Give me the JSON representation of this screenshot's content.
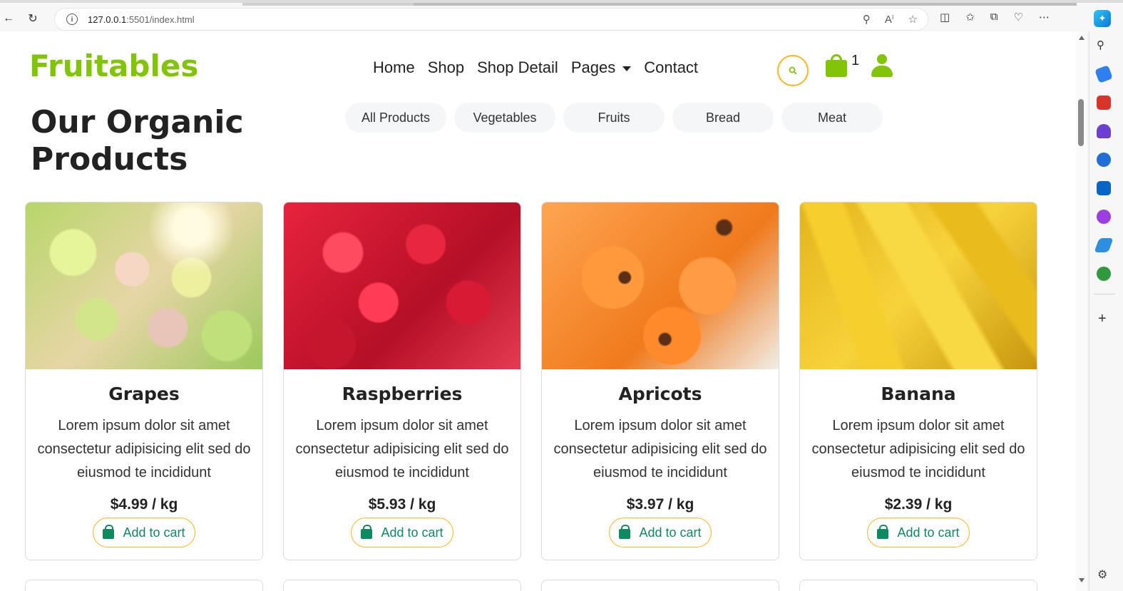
{
  "browser": {
    "url_host": "127.0.0.1",
    "url_rest": ":5501/index.html"
  },
  "site": {
    "brand": "Fruitables",
    "nav": [
      "Home",
      "Shop",
      "Shop Detail",
      "Pages",
      "Contact"
    ],
    "cart_count": "1"
  },
  "section": {
    "title": "Our Organic Products",
    "filters": [
      "All Products",
      "Vegetables",
      "Fruits",
      "Bread",
      "Meat"
    ]
  },
  "products": [
    {
      "name": "Grapes",
      "description": "Lorem ipsum dolor sit amet consectetur adipisicing elit sed do eiusmod te incididunt",
      "price": "$4.99 / kg",
      "button": "Add to cart",
      "image": "grapes"
    },
    {
      "name": "Raspberries",
      "description": "Lorem ipsum dolor sit amet consectetur adipisicing elit sed do eiusmod te incididunt",
      "price": "$5.93 / kg",
      "button": "Add to cart",
      "image": "raspberries"
    },
    {
      "name": "Apricots",
      "description": "Lorem ipsum dolor sit amet consectetur adipisicing elit sed do eiusmod te incididunt",
      "price": "$3.97 / kg",
      "button": "Add to cart",
      "image": "apricots"
    },
    {
      "name": "Banana",
      "description": "Lorem ipsum dolor sit amet consectetur adipisicing elit sed do eiusmod te incididunt",
      "price": "$2.39 / kg",
      "button": "Add to cart",
      "image": "banana"
    }
  ],
  "colors": {
    "brand_green": "#81c408",
    "accent_orange": "#ffb524",
    "button_text": "#0f8a5f"
  },
  "icons": [
    "back-icon",
    "refresh-icon",
    "site-info-icon",
    "zoom-icon",
    "read-aloud-icon",
    "favorite-icon",
    "split-screen-icon",
    "favorites-icon",
    "collections-icon",
    "browser-essentials-icon",
    "more-icon",
    "copilot-icon",
    "search-icon",
    "cart-icon",
    "user-icon"
  ]
}
